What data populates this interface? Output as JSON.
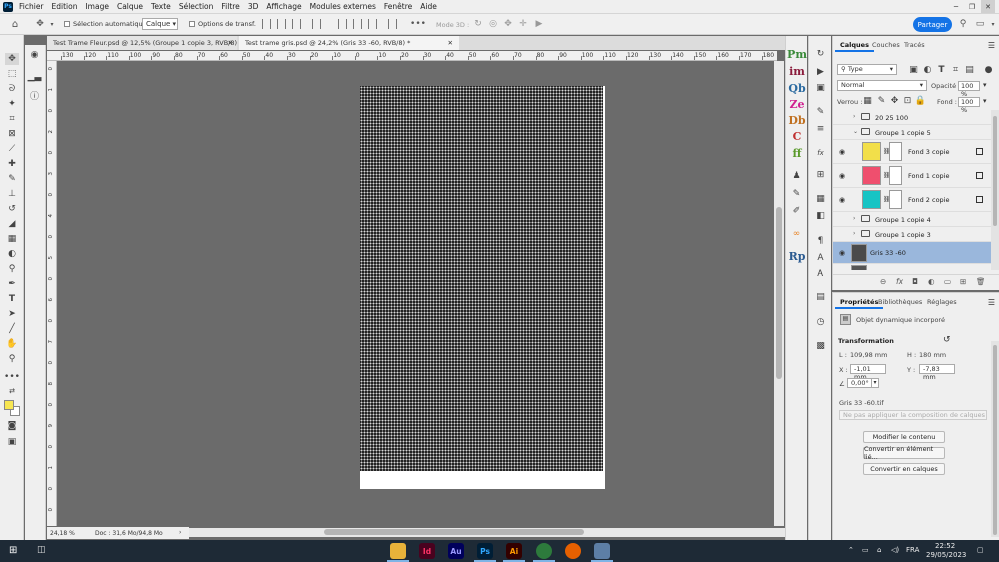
{
  "menubar": {
    "app_icon": "Ps",
    "items": [
      "Fichier",
      "Edition",
      "Image",
      "Calque",
      "Texte",
      "Sélection",
      "Filtre",
      "3D",
      "Affichage",
      "Modules externes",
      "Fenêtre",
      "Aide"
    ]
  },
  "optbar": {
    "auto_select_label": "Sélection automatique :",
    "auto_select_value": "Calque",
    "transform_options_label": "Options de transf.",
    "mode3d_label": "Mode 3D :",
    "share_label": "Partager"
  },
  "tabs": [
    {
      "label": "Test Trame Fleur.psd @ 12,5% (Groupe 1 copie 3, RVB/8)"
    },
    {
      "label": "Test trame gris.psd @ 24,2% (Gris 33 -60, RVB/8) *"
    }
  ],
  "ruler_h": [
    "130",
    "120",
    "110",
    "100",
    "90",
    "80",
    "70",
    "60",
    "50",
    "40",
    "30",
    "20",
    "10",
    "0",
    "10",
    "20",
    "30",
    "40",
    "50",
    "60",
    "70",
    "80",
    "90",
    "100",
    "110",
    "120",
    "130",
    "140",
    "150",
    "160",
    "170",
    "180"
  ],
  "ruler_v": [
    "0",
    "1",
    "0",
    "2",
    "0",
    "3",
    "0",
    "4",
    "0",
    "5",
    "0",
    "6",
    "0",
    "7",
    "0",
    "8",
    "0",
    "9",
    "0",
    "1",
    "0",
    "0"
  ],
  "statusbar": {
    "zoom": "24,18 %",
    "doc_info": "Doc : 31,6 Mo/94,8 Mo"
  },
  "plugins": [
    {
      "label": "Pm",
      "color": "#3a8a3a"
    },
    {
      "label": "im",
      "color": "#8a1c3c"
    },
    {
      "label": "Qb",
      "color": "#2a6aa0"
    },
    {
      "label": "Ze",
      "color": "#d02090"
    },
    {
      "label": "Db",
      "color": "#c07020"
    },
    {
      "label": "C",
      "color": "#c03030"
    },
    {
      "label": "ff",
      "color": "#5a9a2a"
    },
    {
      "label": "Rp",
      "color": "#2a5a90"
    }
  ],
  "layers_panel": {
    "tabs": [
      "Calques",
      "Couches",
      "Tracés"
    ],
    "filter_placeholder": "Type",
    "blend_mode": "Normal",
    "opacity_label": "Opacité :",
    "opacity_value": "100 %",
    "lock_label": "Verrou :",
    "fill_label": "Fond :",
    "fill_value": "100 %",
    "layers": [
      {
        "name": "20 25 100",
        "type": "group",
        "visible": false
      },
      {
        "name": "Groupe 1 copie 5",
        "type": "group",
        "visible": false,
        "expanded": true
      },
      {
        "name": "Fond 3 copie",
        "type": "smart",
        "visible": true,
        "color": "#f2df4a"
      },
      {
        "name": "Fond 1 copie",
        "type": "smart",
        "visible": true,
        "color": "#ef4f6e"
      },
      {
        "name": "Fond 2 copie",
        "type": "smart",
        "visible": true,
        "color": "#17c4c4"
      },
      {
        "name": "Groupe 1 copie 4",
        "type": "group",
        "visible": false
      },
      {
        "name": "Groupe 1 copie 3",
        "type": "group",
        "visible": false
      },
      {
        "name": "Gris 33 -60",
        "type": "smart",
        "visible": true,
        "selected": true,
        "color": "#4a4a4a"
      }
    ]
  },
  "properties_panel": {
    "tabs": [
      "Propriétés",
      "Bibliothèques",
      "Réglages"
    ],
    "object_type": "Objet dynamique incorporé",
    "section": "Transformation",
    "L_label": "L :",
    "L_value": "109,98 mm",
    "H_label": "H :",
    "H_value": "180 mm",
    "X_label": "X :",
    "X_value": "-1,01 mm",
    "Y_label": "Y :",
    "Y_value": "-7,83 mm",
    "angle_value": "0,00°",
    "file_name": "Gris 33 -60.tif",
    "comp_placeholder": "Ne pas appliquer la composition de calques",
    "btn_edit": "Modifier le contenu",
    "btn_convert_linked": "Convertir en élément lié...",
    "btn_convert_layers": "Convertir en calques"
  },
  "taskbar": {
    "apps": [
      {
        "label": "",
        "bg": "#e8b23a",
        "fg": "#fff"
      },
      {
        "label": "Id",
        "bg": "#49021f",
        "fg": "#ff3366"
      },
      {
        "label": "Au",
        "bg": "#00005b",
        "fg": "#9999ff"
      },
      {
        "label": "Ps",
        "bg": "#001e36",
        "fg": "#31a8ff"
      },
      {
        "label": "Ai",
        "bg": "#330000",
        "fg": "#ff9a00"
      },
      {
        "label": "",
        "bg": "#2d7a3c",
        "fg": "#fff"
      },
      {
        "label": "",
        "bg": "#e66000",
        "fg": "#fff"
      },
      {
        "label": "",
        "bg": "#5d7fa6",
        "fg": "#fff"
      }
    ],
    "language": "FRA",
    "time": "22:52",
    "date": "29/05/2023"
  }
}
